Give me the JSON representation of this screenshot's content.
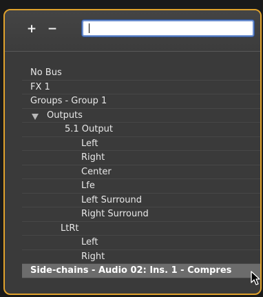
{
  "toolbar": {
    "add_label": "+",
    "remove_label": "−",
    "search_value": ""
  },
  "list": {
    "items": [
      {
        "label": "No Bus",
        "level": 0
      },
      {
        "label": "FX 1",
        "level": 0
      },
      {
        "label": "Groups - Group 1",
        "level": 0
      },
      {
        "label": "Outputs",
        "level": 0,
        "expanded": true
      },
      {
        "label": "5.1 Output",
        "level": 1
      },
      {
        "label": "Left",
        "level": 2
      },
      {
        "label": "Right",
        "level": 2
      },
      {
        "label": "Center",
        "level": 2
      },
      {
        "label": "Lfe",
        "level": 2
      },
      {
        "label": "Left Surround",
        "level": 2
      },
      {
        "label": "Right Surround",
        "level": 2
      },
      {
        "label": "LtRt",
        "level": 1
      },
      {
        "label": "Left",
        "level": 2
      },
      {
        "label": "Right",
        "level": 2
      },
      {
        "label": "Side-chains - Audio 02: Ins. 1 - Compres",
        "level": 0,
        "selected": true
      }
    ]
  },
  "colors": {
    "frame_border": "#e2a32c",
    "background": "#3a3a3a",
    "selected_row": "#6c6c6c",
    "search_focus": "#6c8fcf"
  },
  "icons": {
    "expand": "triangle-down-icon",
    "cursor": "mouse-pointer-icon"
  }
}
